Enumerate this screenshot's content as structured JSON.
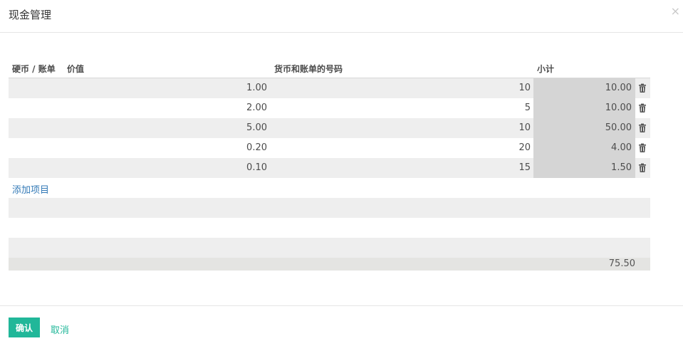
{
  "dialog": {
    "title": "现金管理",
    "close_glyph": "×"
  },
  "table": {
    "headers": {
      "coin": "硬币 / 账单",
      "value": "价值",
      "number": "货币和账单的号码",
      "subtotal": "小计"
    },
    "rows": [
      {
        "value": "1.00",
        "number": "10",
        "subtotal": "10.00"
      },
      {
        "value": "2.00",
        "number": "5",
        "subtotal": "10.00"
      },
      {
        "value": "5.00",
        "number": "10",
        "subtotal": "50.00"
      },
      {
        "value": "0.20",
        "number": "20",
        "subtotal": "4.00"
      },
      {
        "value": "0.10",
        "number": "15",
        "subtotal": "1.50"
      }
    ],
    "add_item": "添加项目",
    "total": "75.50",
    "delete_icon": "trash-icon"
  },
  "footer": {
    "confirm": "确认",
    "cancel": "取消"
  },
  "colors": {
    "accent": "#21b799",
    "link": "#337ab7",
    "row_stripe": "#eeeeee",
    "subtotal_bg": "#d5d5d5"
  }
}
